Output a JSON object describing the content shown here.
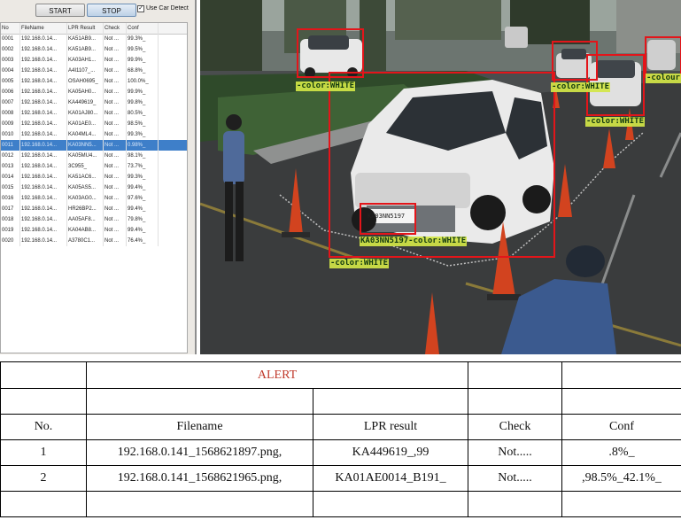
{
  "toolbar": {
    "start_label": "START",
    "stop_label": "STOP",
    "checkbox_mark": "✓",
    "car_detect_label": "Use Car Detect"
  },
  "grid": {
    "headers": [
      "No",
      "FileName",
      "LPR Result",
      "Check",
      "Conf"
    ],
    "rows": [
      [
        "0001",
        "192.168.0.14...",
        "KA51AB9...",
        "Not ...",
        "99.3%_"
      ],
      [
        "0002",
        "192.168.0.14...",
        "KA51AB9...",
        "Not ...",
        "99.5%_"
      ],
      [
        "0003",
        "192.168.0.14...",
        "KA03AH1...",
        "Not ...",
        "99.9%_"
      ],
      [
        "0004",
        "192.168.0.14...",
        "A4I1107_...",
        "Not ...",
        "68.8%_"
      ],
      [
        "0005",
        "192.168.0.14...",
        "OSAH0695_",
        "Not ...",
        "100.0%_"
      ],
      [
        "0006",
        "192.168.0.14...",
        "KA05AH0...",
        "Not ...",
        "99.9%_"
      ],
      [
        "0007",
        "192.168.0.14...",
        "KA449619_",
        "Not ...",
        "99.8%_"
      ],
      [
        "0008",
        "192.168.0.14...",
        "KA01AJ80...",
        "Not ...",
        "80.5%_"
      ],
      [
        "0009",
        "192.168.0.14...",
        "KA01AE0...",
        "Not ...",
        "98.5%_"
      ],
      [
        "0010",
        "192.168.0.14...",
        "KA04ML4...",
        "Not ...",
        "99.3%_"
      ],
      [
        "0011",
        "192.168.0.14...",
        "KA03NN5...",
        "Not ...",
        "0.98%_"
      ],
      [
        "0012",
        "192.168.0.14...",
        "KA05MU4...",
        "Not ...",
        "98.1%_"
      ],
      [
        "0013",
        "192.168.0.14...",
        "3C955_",
        "Not ...",
        "73.7%_"
      ],
      [
        "0014",
        "192.168.0.14...",
        "KA51AC6...",
        "Not ...",
        "99.3%_"
      ],
      [
        "0015",
        "192.168.0.14...",
        "KA05AS5...",
        "Not ...",
        "99.4%_"
      ],
      [
        "0016",
        "192.168.0.14...",
        "KA03AG0...",
        "Not ...",
        "97.6%_"
      ],
      [
        "0017",
        "192.168.0.14...",
        "HR26BP2...",
        "Not ...",
        "99.4%_"
      ],
      [
        "0018",
        "192.168.0.14...",
        "AA05AF8...",
        "Not ...",
        "79.8%_"
      ],
      [
        "0019",
        "192.168.0.14...",
        "KA04AB8...",
        "Not ...",
        "99.4%_"
      ],
      [
        "0020",
        "192.168.0.14...",
        "A3780C1...",
        "Not ...",
        "76.4%_"
      ]
    ],
    "selected_row": "0011"
  },
  "feed": {
    "box_color": "#e3151a",
    "label_color": "#d2e646",
    "labels": {
      "car_topleft": "-color:WHITE",
      "car_right1": "-color:WHITE",
      "car_right2": "-color:WHITE",
      "car_far_right": "-colour",
      "car_main": "-color:WHITE",
      "plate_main": "KA03NN5197-color:WHITE"
    },
    "plate_text": "KA03NN5197"
  },
  "alert_table": {
    "title": "ALERT",
    "headers": {
      "no": "No.",
      "filename": "Filename",
      "lpr": "LPR result",
      "check": "Check",
      "conf": "Conf"
    },
    "rows": [
      {
        "no": "1",
        "filename": "192.168.0.141_1568621897.png,",
        "lpr": "KA449619_,99",
        "check": "Not.....",
        "conf": ".8%_"
      },
      {
        "no": "2",
        "filename": "192.168.0.141_1568621965.png,",
        "lpr": "KA01AE0014_B191_",
        "check": "Not.....",
        "conf": ",98.5%_42.1%_"
      }
    ]
  }
}
